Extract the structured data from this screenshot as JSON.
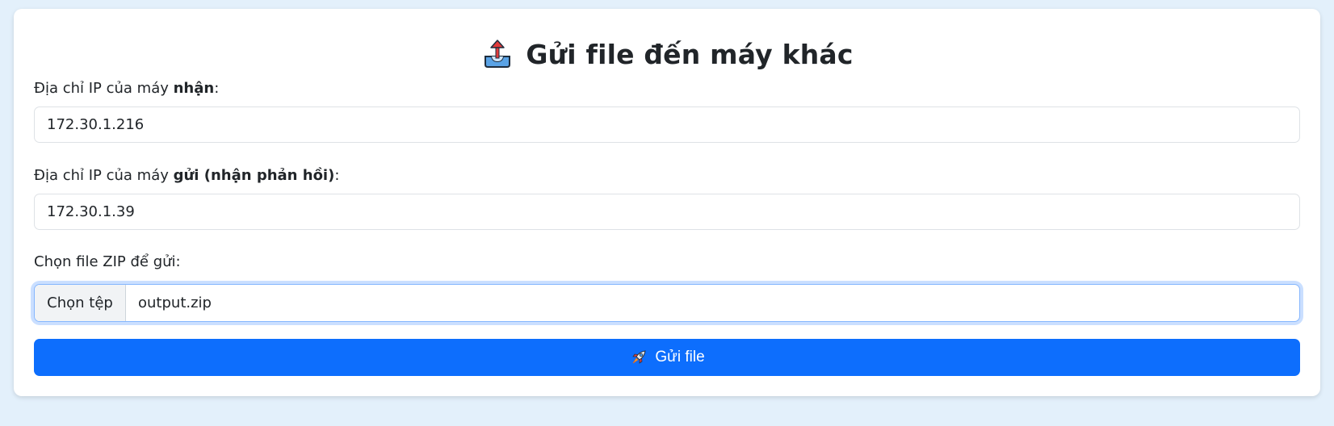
{
  "page": {
    "title": "Gửi file đến máy khác",
    "title_icon": "outbox-tray-icon",
    "background_color": "#e3f0fb",
    "accent_color": "#0d6efd"
  },
  "form": {
    "receiver": {
      "label_prefix": "Địa chỉ IP của máy ",
      "label_bold": "nhận",
      "label_suffix": ":",
      "value": "172.30.1.216"
    },
    "sender": {
      "label_prefix": "Địa chỉ IP của máy ",
      "label_bold": "gửi (nhận phản hồi)",
      "label_suffix": ":",
      "value": "172.30.1.39"
    },
    "file": {
      "label": "Chọn file ZIP để gửi:",
      "button_label": "Chọn tệp",
      "file_name": "output.zip"
    },
    "submit": {
      "label": "Gửi file",
      "icon": "rocket-icon"
    }
  }
}
